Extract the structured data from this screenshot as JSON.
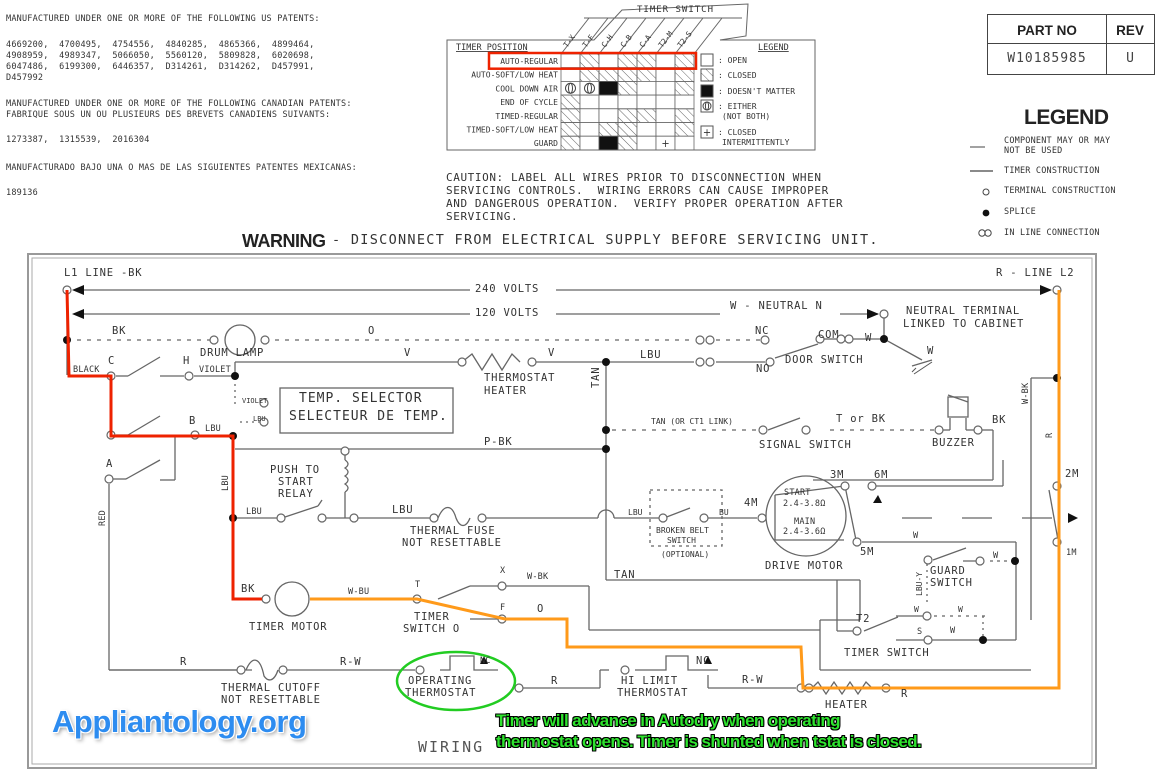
{
  "patents": {
    "us_heading": "MANUFACTURED UNDER ONE OR MORE OF THE FOLLOWING US PATENTS:",
    "us_lines": [
      "4669200,  4700495,  4754556,  4840285,  4865366,  4899464,",
      "4908959,  4989347,  5066050,  5560120,  5809828,  6020698,",
      "6047486,  6199300,  6446357,  D314261,  D314262,  D457991,",
      "D457992"
    ],
    "ca_heading_1": "MANUFACTURED UNDER ONE OR MORE OF THE FOLLOWING CANADIAN PATENTS:",
    "ca_heading_2": "FABRIQUE SOUS UN OU PLUSIEURS DES BREVETS CANADIENS SUIVANTS:",
    "ca_numbers": "1273387,  1315539,  2016304",
    "mx_heading": "MANUFACTURADO BAJO UNA O MAS DE LAS SIGUIENTES PATENTES MEXICANAS:",
    "mx_numbers": "189136"
  },
  "timer_chart": {
    "title": "TIMER SWITCH",
    "row_header": "TIMER POSITION",
    "columns": [
      "T-X",
      "T-F",
      "C-H",
      "C-B",
      "C-A",
      "T2-M",
      "T2-S"
    ],
    "highlighted_row": "AUTO-REGULAR",
    "highlight_color": "#ee2200",
    "rows": [
      {
        "label": "AUTO-REGULAR",
        "cells": [
          "open",
          "closed",
          "open",
          "closed",
          "closed",
          "open",
          "closed"
        ]
      },
      {
        "label": "AUTO-SOFT/LOW HEAT",
        "cells": [
          "open",
          "closed",
          "closed",
          "closed",
          "closed",
          "open",
          "closed"
        ]
      },
      {
        "label": "COOL DOWN    AIR",
        "cells": [
          "either",
          "either",
          "dontcare",
          "closed",
          "open",
          "open",
          "closed"
        ]
      },
      {
        "label": "END OF CYCLE",
        "cells": [
          "closed",
          "open",
          "open",
          "open",
          "open",
          "open",
          "open"
        ]
      },
      {
        "label": "TIMED-REGULAR",
        "cells": [
          "closed",
          "open",
          "open",
          "closed",
          "closed",
          "open",
          "closed"
        ]
      },
      {
        "label": "TIMED-SOFT/LOW HEAT",
        "cells": [
          "closed",
          "open",
          "closed",
          "closed",
          "open",
          "open",
          "closed"
        ]
      },
      {
        "label": "GUARD",
        "cells": [
          "closed",
          "open",
          "dontcare",
          "closed",
          "open",
          "intermittent",
          "open"
        ]
      }
    ],
    "legend_title": "LEGEND",
    "legend": [
      {
        "symbol": "open",
        "text": ": OPEN"
      },
      {
        "symbol": "closed",
        "text": ": CLOSED"
      },
      {
        "symbol": "dontcare",
        "text": ": DOESN'T MATTER"
      },
      {
        "symbol": "either",
        "text": ": EITHER",
        "text2": "(NOT BOTH)"
      },
      {
        "symbol": "intermittent",
        "text": ": CLOSED",
        "text2": "INTERMITTENTLY"
      }
    ]
  },
  "caution": [
    "CAUTION: LABEL ALL WIRES PRIOR TO DISCONNECTION WHEN",
    "SERVICING CONTROLS.  WIRING ERRORS CAN CAUSE IMPROPER",
    "AND DANGEROUS OPERATION.  VERIFY PROPER OPERATION AFTER",
    "SERVICING."
  ],
  "warning": {
    "bold": "WARNING",
    "text": "- DISCONNECT FROM ELECTRICAL SUPPLY BEFORE SERVICING UNIT."
  },
  "part": {
    "part_no_header": "PART NO",
    "rev_header": "REV",
    "part_no": "W10185985",
    "rev": "U"
  },
  "legend": {
    "title": "LEGEND",
    "items": [
      {
        "symbol": "dashed-line",
        "text": "COMPONENT MAY OR MAY",
        "text2": "NOT BE USED"
      },
      {
        "symbol": "solid-line",
        "text": "TIMER CONSTRUCTION"
      },
      {
        "symbol": "open-circle",
        "text": "TERMINAL CONSTRUCTION"
      },
      {
        "symbol": "filled-dot",
        "text": "SPLICE"
      },
      {
        "symbol": "double-circle",
        "text": "IN LINE CONNECTION"
      }
    ]
  },
  "schematic": {
    "l1_label": "L1 LINE -BK",
    "l2_label": "R - LINE L2",
    "v240": "240 VOLTS",
    "v120": "120 VOLTS",
    "neutral": "W - NEUTRAL N",
    "neutral_terminal_1": "NEUTRAL TERMINAL",
    "neutral_terminal_2": "LINKED TO CABINET",
    "bk": "BK",
    "o": "O",
    "nc": "NC",
    "com": "COM",
    "w": "W",
    "drum_lamp": "DRUM LAMP",
    "v": "V",
    "lbu": "LBU",
    "no": "NO",
    "door_switch": "DOOR SWITCH",
    "black": "BLACK",
    "c": "C",
    "h": "H",
    "violet": "VIOLET",
    "thermostat_heater_1": "THERMOSTAT",
    "thermostat_heater_2": "HEATER",
    "tan": "TAN",
    "temp_selector_1": "TEMP. SELECTOR",
    "temp_selector_2": "SELECTEUR DE TEMP.",
    "b": "B",
    "tan_link": "TAN (OR CT1 LINK)",
    "t_or_bk": "T or BK",
    "signal_switch": "SIGNAL SWITCH",
    "buzzer": "BUZZER",
    "w_bk": "W-BK",
    "r": "R",
    "p_bk": "P-BK",
    "a": "A",
    "red": "RED",
    "push_to_start_1": "PUSH TO",
    "push_to_start_2": "START",
    "push_to_start_3": "RELAY",
    "thermal_fuse_1": "THERMAL FUSE",
    "thermal_fuse_2": "NOT RESETTABLE",
    "broken_belt_1": "BROKEN BELT",
    "broken_belt_2": "SWITCH",
    "optional": "(OPTIONAL)",
    "bu": "BU",
    "m4": "4M",
    "m3": "3M",
    "m6": "6M",
    "m5": "5M",
    "m2": "2M",
    "m1": "1M",
    "start": "START",
    "start_ohm": "2.4-3.8Ω",
    "main": "MAIN",
    "main_ohm": "2.4-3.6Ω",
    "drive_motor": "DRIVE MOTOR",
    "timer_motor": "TIMER MOTOR",
    "w_bu": "W-BU",
    "t": "T",
    "x": "X",
    "f": "F",
    "timer_switch_0_1": "TIMER",
    "timer_switch_0_2": "SWITCH O",
    "guard_switch_1": "GUARD",
    "guard_switch_2": "SWITCH",
    "lbu_y": "LBU-Y",
    "t2": "T2",
    "s": "S",
    "timer_switch": "TIMER SWITCH",
    "r_w": "R-W",
    "thermal_cutoff_1": "THERMAL CUTOFF",
    "thermal_cutoff_2": "NOT RESETTABLE",
    "operating_thermostat_1": "OPERATING",
    "operating_thermostat_2": "THERMOSTAT",
    "hi_limit_1": "HI LIMIT",
    "hi_limit_2": "THERMOSTAT",
    "heater": "HEATER",
    "wiring": "WIRING",
    "colors": {
      "wire": "#555555",
      "highlight_path_red": "#ee2200",
      "highlight_path_orange": "#ff9a1a",
      "thermostat_circle": "#22cc22"
    }
  },
  "annotation": {
    "brand": "Appliantology.org",
    "note_line_1": "Timer will advance in Autodry when operating",
    "note_line_2": "thermostat opens. Timer is shunted when tstat is closed."
  }
}
